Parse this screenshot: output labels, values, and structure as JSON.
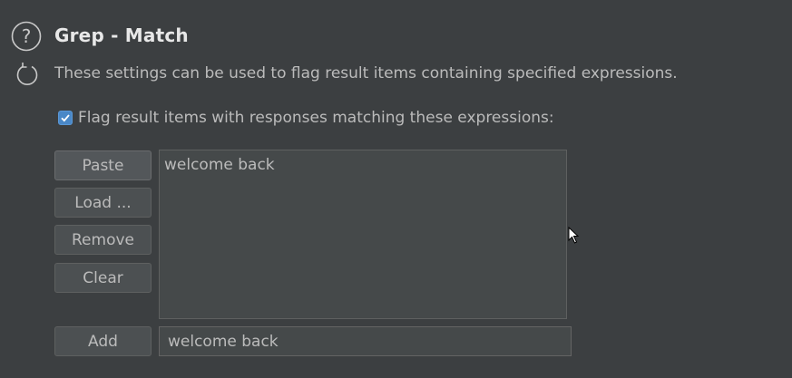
{
  "section": {
    "title": "Grep - Match",
    "description": "These settings can be used to flag result items containing specified expressions."
  },
  "icons": {
    "help": "help-circle-icon",
    "refresh": "refresh-icon",
    "check": "checkmark-icon",
    "cursor": "mouse-pointer-icon"
  },
  "flag_option": {
    "label": "Flag result items with responses matching these expressions:",
    "checked": true
  },
  "buttons": {
    "paste": "Paste",
    "load": "Load ...",
    "remove": "Remove",
    "clear": "Clear",
    "add": "Add"
  },
  "expressions_list": {
    "items": [
      "welcome back"
    ]
  },
  "add_input": {
    "value": "welcome back"
  },
  "colors": {
    "background": "#3c3f41",
    "accent": "#4a88c7",
    "text": "#bbbbbb",
    "title": "#e8e8e8"
  }
}
